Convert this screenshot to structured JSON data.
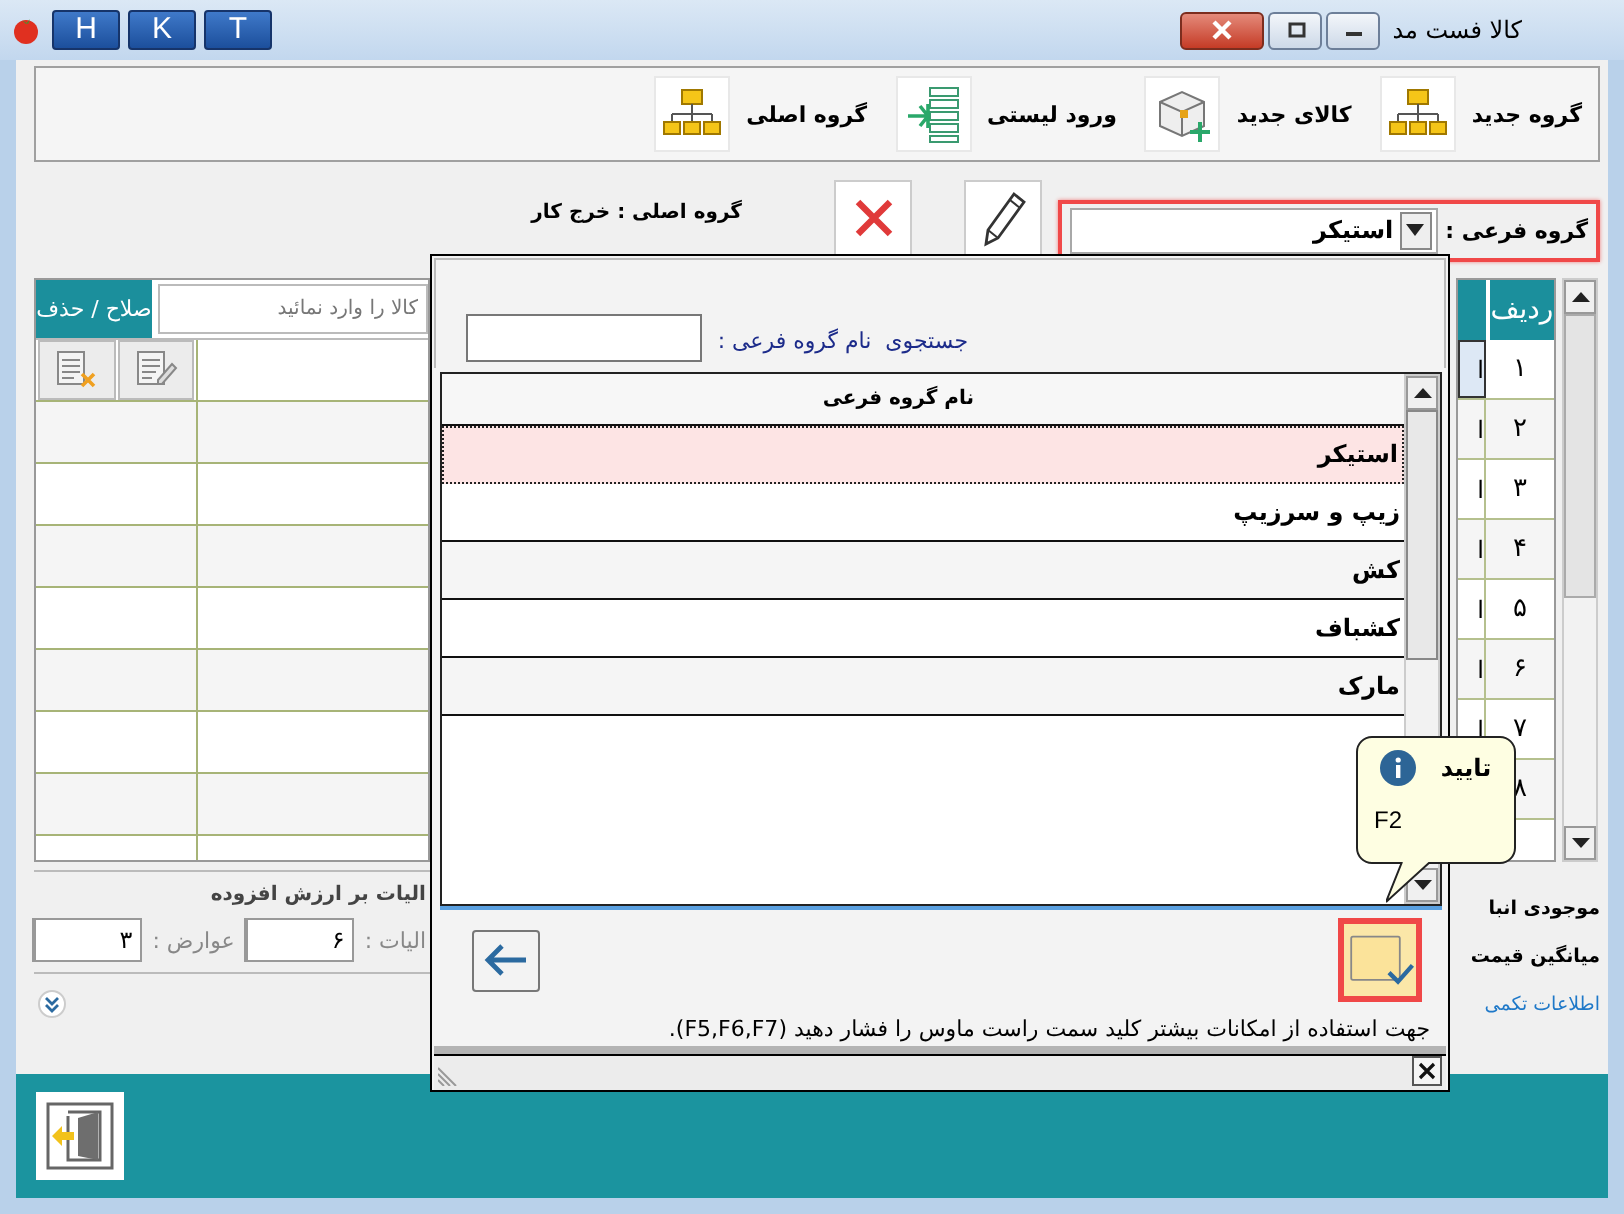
{
  "window": {
    "title": "کالا فست مد",
    "shortcut_buttons": [
      "T",
      "K",
      "H"
    ]
  },
  "toolbar": [
    {
      "label": "گروه جدید",
      "kind": "hierarchy"
    },
    {
      "label": "کالای جدید",
      "kind": "package"
    },
    {
      "label": "ورود لیستی",
      "kind": "list"
    },
    {
      "label": "گروه اصلی",
      "kind": "hierarchy"
    }
  ],
  "subgroup": {
    "label": "گروه فرعی :",
    "value": "استیکر",
    "highlighted": true
  },
  "main_group": "گروه اصلی : خرج کار",
  "items_table": {
    "action_header": "صلاح / حذف",
    "search_placeholder": "کالا را وارد نمائید",
    "row_header": "ردیف",
    "rows": [
      {
        "number": "۱",
        "column_2": "ا",
        "selected": true
      },
      {
        "number": "۲",
        "column_2": "ا",
        "selected": false
      },
      {
        "number": "۳",
        "column_2": "ا",
        "selected": false
      },
      {
        "number": "۴",
        "column_2": "ا",
        "selected": false
      },
      {
        "number": "۵",
        "column_2": "ا",
        "selected": false
      },
      {
        "number": "۶",
        "column_2": "ا",
        "selected": false
      },
      {
        "number": "۷",
        "column_2": "ا",
        "selected": false
      },
      {
        "number": "۸"
      }
    ]
  },
  "tax": {
    "title": "الیات بر ارزش افزوده",
    "fields": [
      {
        "label": "الیات :",
        "value": "۶"
      },
      {
        "label": "عوارض :",
        "value": "۳"
      }
    ]
  },
  "side_info": [
    {
      "text": "موجودی انبا",
      "kind": "label"
    },
    {
      "text": "میانگین قیمت",
      "kind": "label"
    },
    {
      "text": "اطلاعات تکمی",
      "kind": "link"
    }
  ],
  "popup": {
    "search_label": "جستجوی  نام گروه فرعی :",
    "column": "نام گروه فرعی",
    "rows": [
      {
        "name": "استیکر",
        "selected": true
      },
      {
        "name": "زیپ و سرزیپ",
        "selected": false
      },
      {
        "name": "کش",
        "selected": false
      },
      {
        "name": "کشباف",
        "selected": false
      },
      {
        "name": "مارک",
        "selected": false
      }
    ],
    "confirm": {
      "highlighted": true
    },
    "tooltip": {
      "title": "تایید",
      "shortcut": "F2"
    },
    "status": "جهت استفاده از امکانات بیشتر کلید سمت راست ماوس را فشار دهید (F5,F6,F7)."
  }
}
